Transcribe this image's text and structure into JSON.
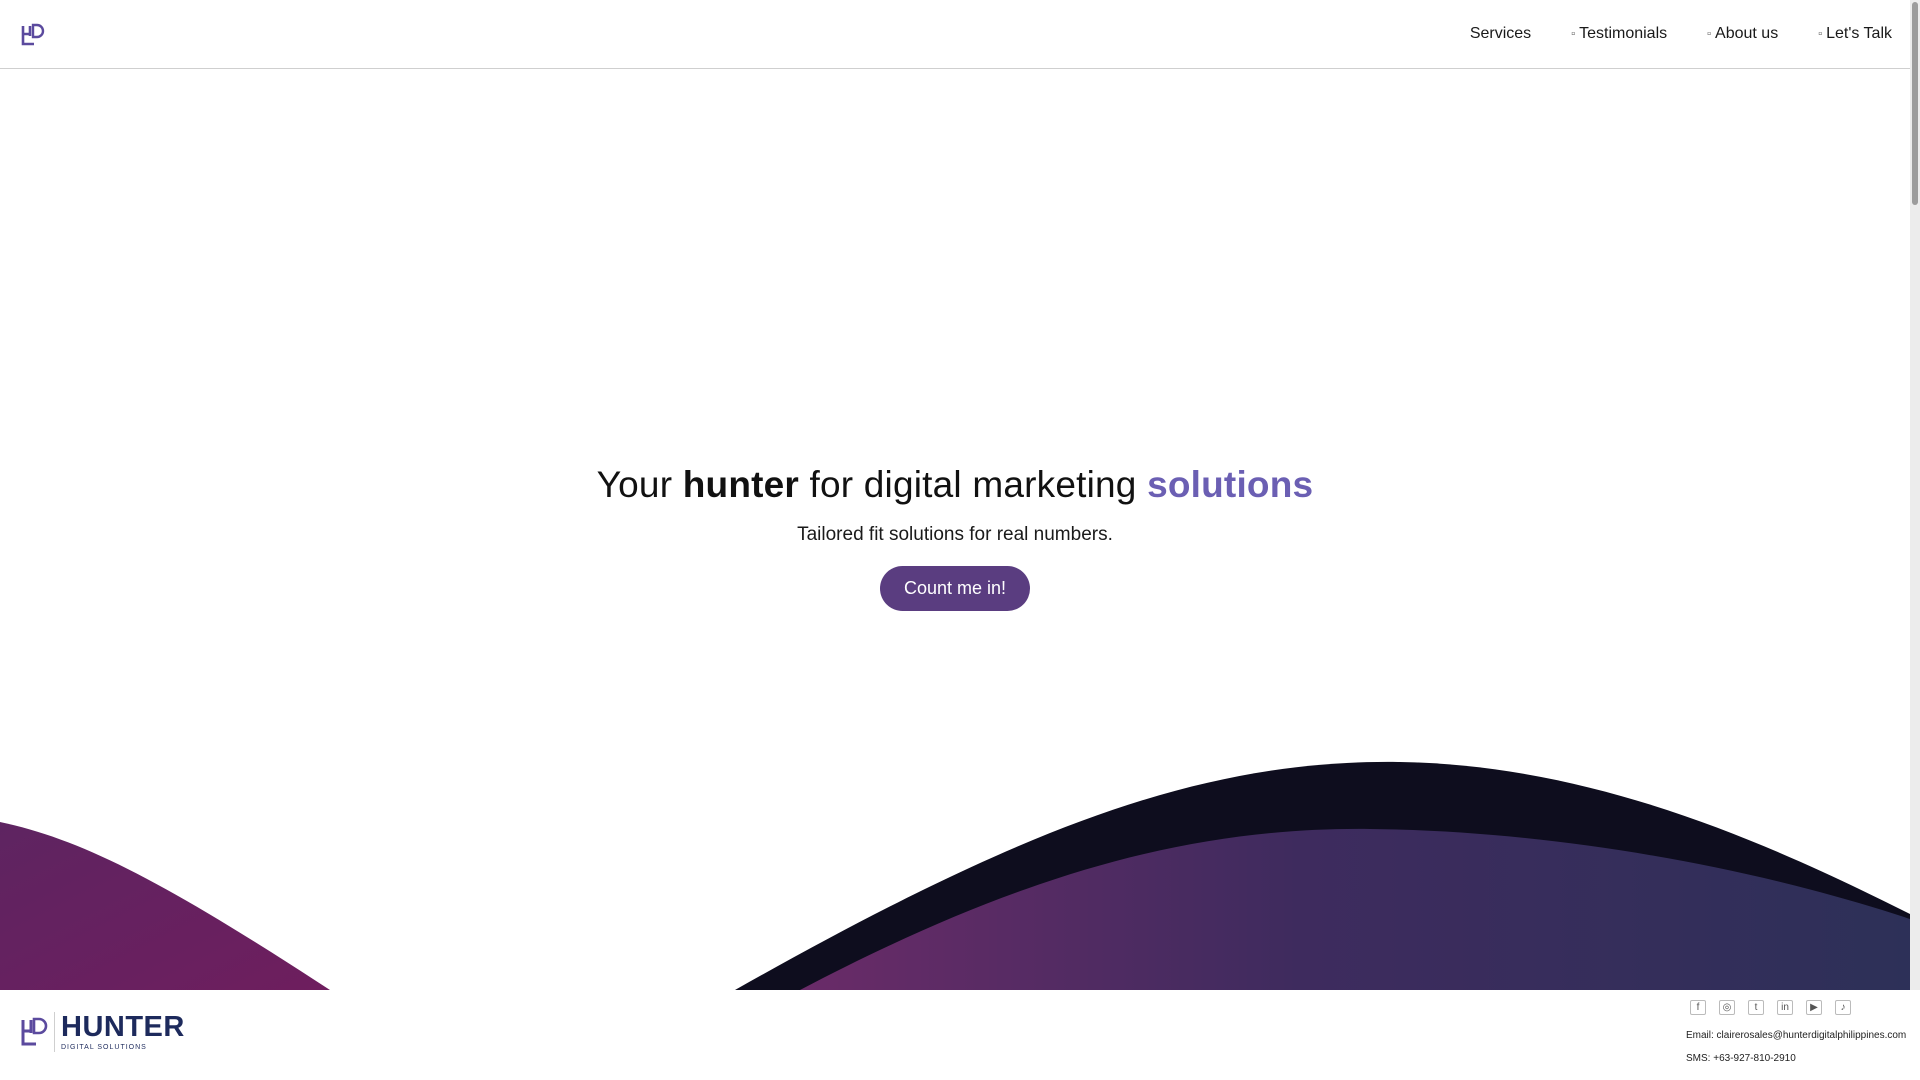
{
  "nav": {
    "items": [
      {
        "label": "Services",
        "glyph": ""
      },
      {
        "label": "Testimonials",
        "glyph": "▫"
      },
      {
        "label": "About us",
        "glyph": "▫"
      },
      {
        "label": "Let's Talk",
        "glyph": "▫"
      }
    ]
  },
  "hero": {
    "headline": {
      "part1": "Your ",
      "bold": "hunter",
      "part2": " for digital marketing ",
      "accent": "solutions"
    },
    "tagline": "Tailored fit solutions for real numbers.",
    "cta_label": "Count me in!"
  },
  "footer": {
    "brand_name": "HUNTER",
    "brand_sub": "DIGITAL SOLUTIONS",
    "social_icons": [
      "facebook-icon",
      "instagram-icon",
      "twitter-icon",
      "linkedin-icon",
      "youtube-icon",
      "tiktok-icon"
    ],
    "email_line": "Email: clairerosales@hunterdigitalphilippines.com",
    "sms_line": "SMS: +63-927-810-2910"
  },
  "colors": {
    "accent": "#6b5fb3",
    "button": "#5a3d80",
    "wave_dark": "#0e0d1e",
    "wave_purple": "#6c2b6a",
    "wave_navy": "#2b2f59",
    "brand_navy": "#1d2a5c"
  }
}
